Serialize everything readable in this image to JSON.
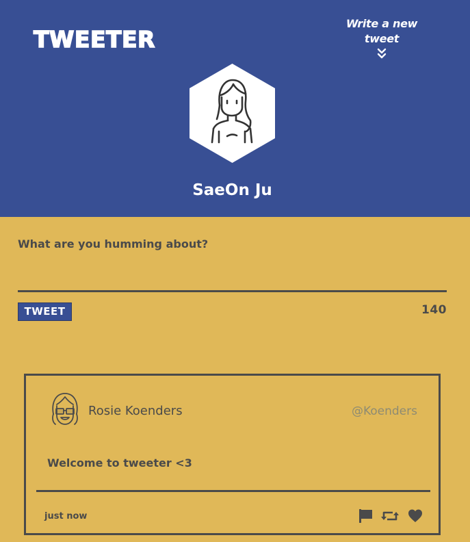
{
  "app": {
    "logo": "TWEETER"
  },
  "header": {
    "compose_toggle": "Write a new tweet",
    "user_name": "SaeOn Ju"
  },
  "compose": {
    "prompt": "What are you humming about?",
    "input_value": "",
    "tweet_button": "TWEET",
    "char_counter": "140"
  },
  "tweets": [
    {
      "name": "Rosie Koenders",
      "handle": "@Koenders",
      "content": "Welcome to tweeter <3",
      "timestamp": "just now",
      "actions": [
        "flag-icon",
        "retweet-icon",
        "heart-icon"
      ]
    }
  ],
  "colors": {
    "header_bg": "#384f94",
    "page_bg": "#e0b858",
    "text": "#4a4a4a",
    "handle": "#8e8b72",
    "white": "#ffffff"
  }
}
